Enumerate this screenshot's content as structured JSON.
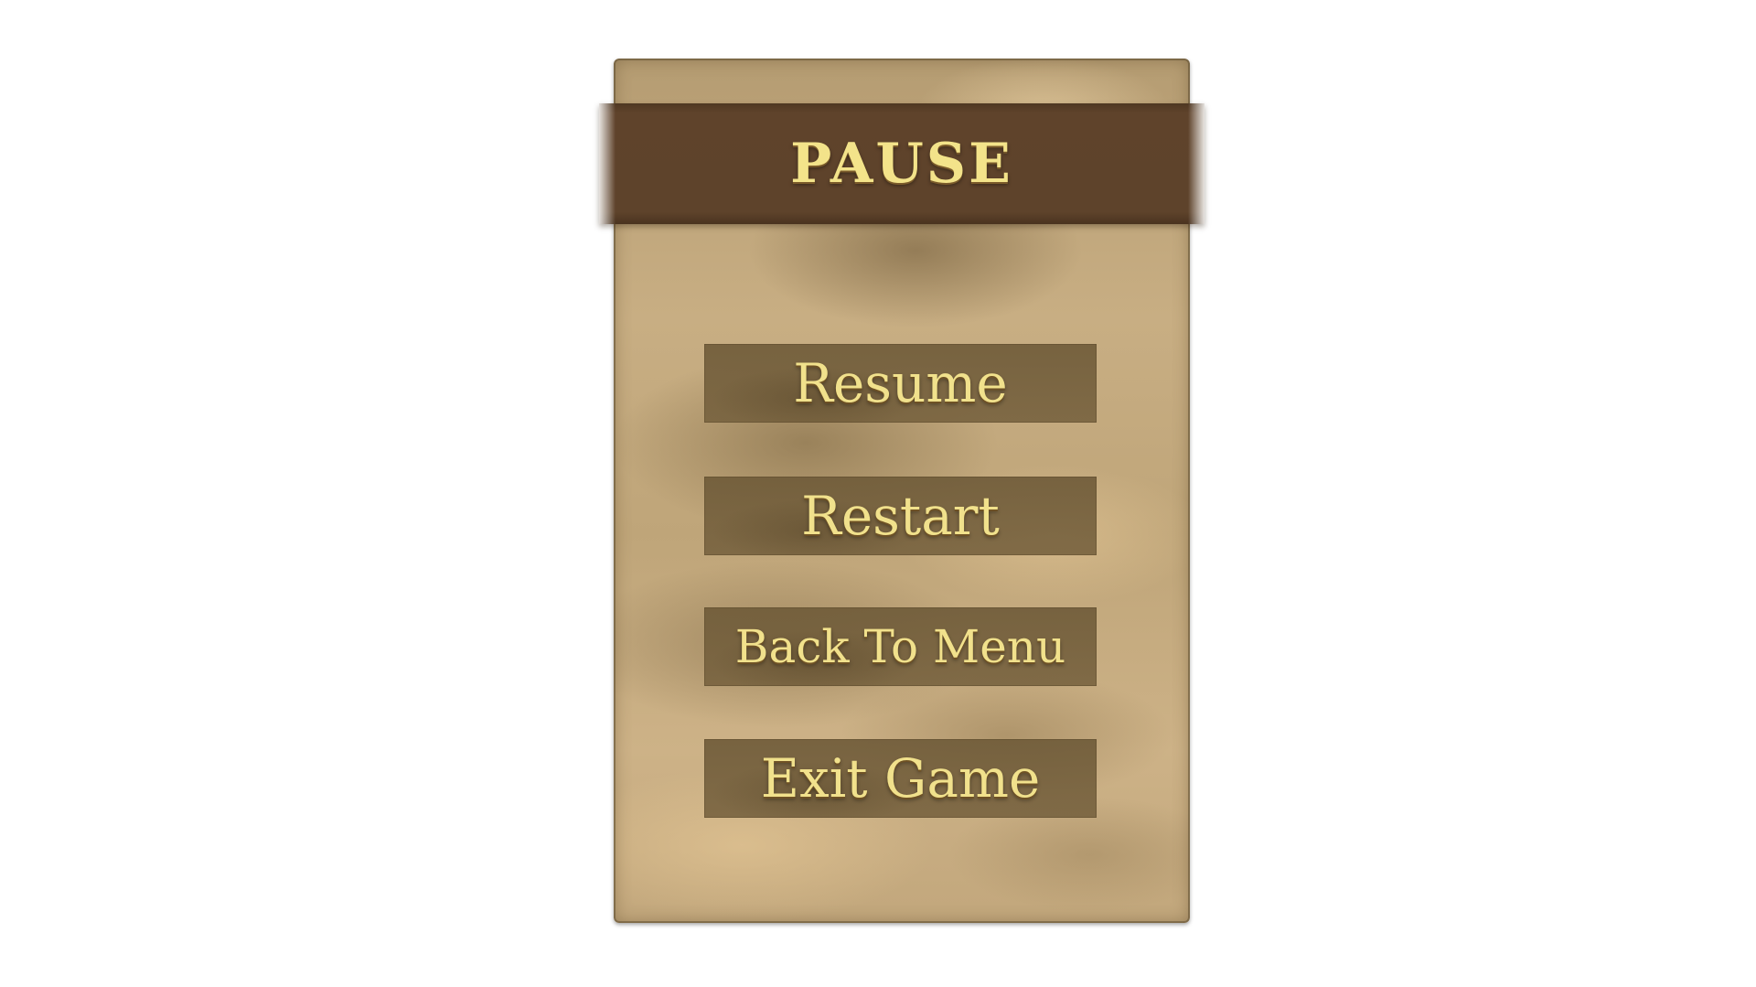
{
  "pause_menu": {
    "title": "PAUSE",
    "buttons": {
      "resume": "Resume",
      "restart": "Restart",
      "back_to_menu": "Back To Menu",
      "exit_game": "Exit Game"
    }
  },
  "colors": {
    "panel_parchment": "#c8ae83",
    "header_band": "#5e432b",
    "button_fill": "#735e3c",
    "text_gold": "#f1e18c"
  }
}
